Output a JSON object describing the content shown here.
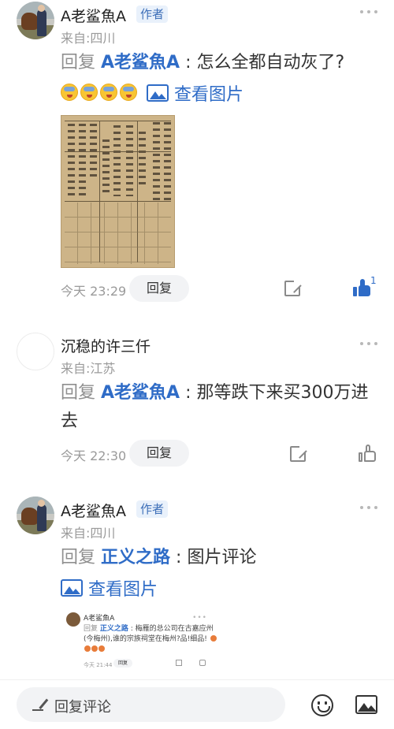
{
  "comments": [
    {
      "username": "A老鲨魚A",
      "tag": "作者",
      "location": "来自:四川",
      "reply_prefix": "回复",
      "mention": "A老鲨魚A",
      "separator": " : ",
      "text": "怎么全都自动灰了?",
      "emoji_count": 4,
      "view_image_label": "查看图片",
      "time": "今天 23:29",
      "reply_button": "回复",
      "like_count": "1",
      "liked": true
    },
    {
      "username": "沉稳的许三仟",
      "location": "来自:江苏",
      "reply_prefix": "回复",
      "mention": "A老鲨魚A",
      "separator": " : ",
      "text": "那等跌下来买300万进去",
      "time": "今天 22:30",
      "reply_button": "回复"
    },
    {
      "username": "A老鲨魚A",
      "tag": "作者",
      "location": "来自:四川",
      "reply_prefix": "回复",
      "mention": "正义之路",
      "separator": " : ",
      "text": "图片评论",
      "view_image_label": "查看图片",
      "embedded": {
        "username": "A老鲨魚A",
        "dots": "•••",
        "reply_prefix": "回复",
        "mention": "正义之路",
        "separator": " : ",
        "text": "梅雁的总公司在古嘉应州(今梅州),谁的宗族祠堂在梅州?品!细品!",
        "time": "今天 21:44",
        "reply_button": "回复"
      }
    }
  ],
  "bottom_bar": {
    "placeholder": "回复评论"
  },
  "colors": {
    "accent": "#2f6cc7",
    "muted": "#9a9a9a"
  }
}
